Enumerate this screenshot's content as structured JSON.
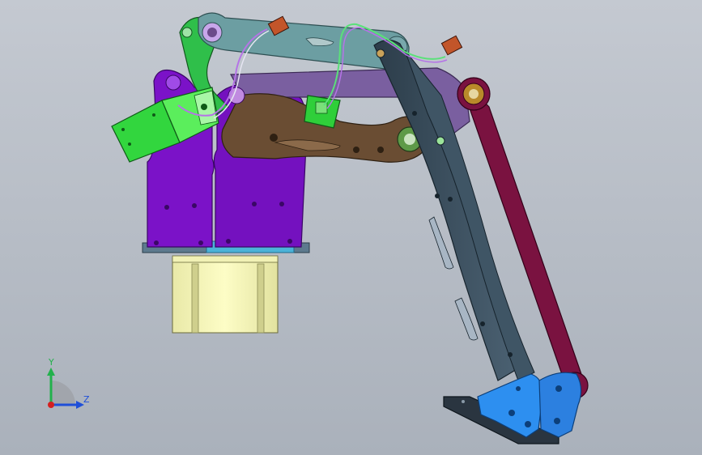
{
  "viewport": {
    "background_top": "#c4c9d1",
    "background_bottom": "#aab1bb"
  },
  "triad": {
    "y_label": "Y",
    "z_label": "Z",
    "y_color": "#22b14c",
    "z_color": "#1f4fd8",
    "x_color": "#d42020"
  },
  "model": {
    "description_parts": [
      "stepper-motor",
      "base-plate",
      "shoulder-bracket-left",
      "shoulder-bracket-right",
      "servo-left",
      "servo-right",
      "green-link",
      "teal-link",
      "purple-link",
      "brown-arm",
      "dark-forearm",
      "maroon-rod",
      "blue-gripper-bracket",
      "end-plate"
    ],
    "colors": {
      "motor": "#fbfbbd",
      "purple": "#7b12c8",
      "green": "#2ec93c",
      "teal": "#6c9ea2",
      "lavender": "#7a5fa0",
      "brown": "#6a4d33",
      "forearm": "#3b4f5e",
      "maroon": "#7a1240",
      "blue": "#2d8ff0",
      "connector": "#c2552a"
    }
  }
}
